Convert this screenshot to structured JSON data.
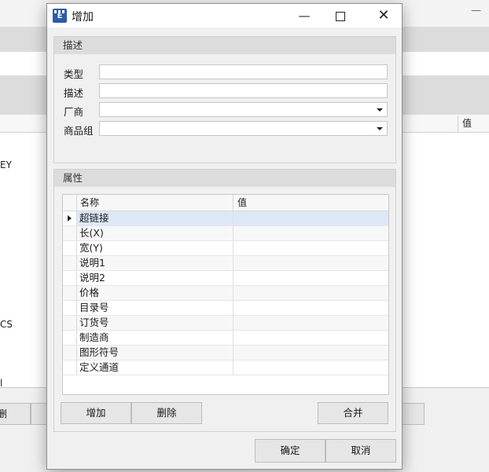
{
  "background": {
    "list_header_value": "值",
    "list_items": [
      "EY",
      "CS",
      "l"
    ],
    "bottom_button": "删"
  },
  "dialog": {
    "title": "增加",
    "app_icon_letter": "E",
    "description_group": {
      "title": "描述",
      "fields": {
        "type_label": "类型",
        "type_value": "",
        "desc_label": "描述",
        "desc_value": "",
        "vendor_label": "厂商",
        "vendor_value": "",
        "product_group_label": "商品组",
        "product_group_value": ""
      }
    },
    "properties_group": {
      "title": "属性",
      "columns": [
        "名称",
        "值"
      ],
      "rows": [
        {
          "name": "超链接",
          "value": ""
        },
        {
          "name": "长(X)",
          "value": ""
        },
        {
          "name": "宽(Y)",
          "value": ""
        },
        {
          "name": "说明1",
          "value": ""
        },
        {
          "name": "说明2",
          "value": ""
        },
        {
          "name": "价格",
          "value": ""
        },
        {
          "name": "目录号",
          "value": ""
        },
        {
          "name": "订货号",
          "value": ""
        },
        {
          "name": "制造商",
          "value": ""
        },
        {
          "name": "图形符号",
          "value": ""
        },
        {
          "name": "定义通道",
          "value": ""
        }
      ],
      "selected_row_index": 0,
      "add_button": "增加",
      "delete_button": "删除",
      "merge_button": "合并"
    },
    "ok_button": "确定",
    "cancel_button": "取消"
  }
}
